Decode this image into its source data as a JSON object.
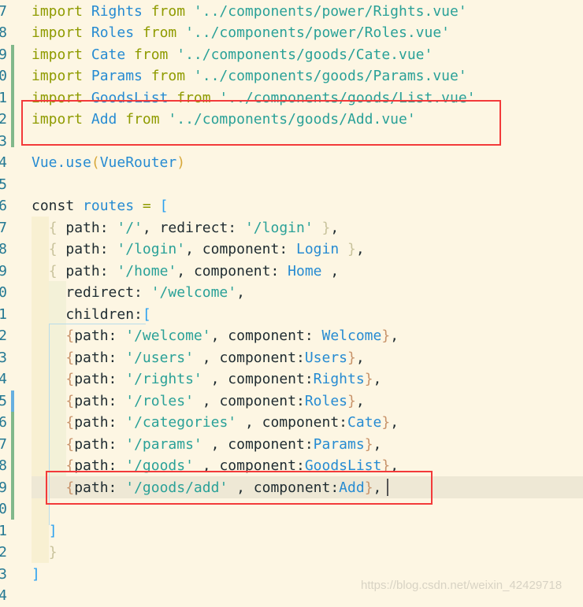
{
  "editor": {
    "colors": {
      "keyword": "#8f9b00",
      "identifier": "#268bd2",
      "string": "#2aa198",
      "highlight_box": "#f33a3a",
      "background": "#fdf6e3"
    },
    "lines": [
      {
        "n": "7",
        "tokens": [
          [
            "k",
            "import "
          ],
          [
            "i",
            "Rights "
          ],
          [
            "k",
            "from "
          ],
          [
            "s",
            "'../components/power/Rights.vue'"
          ]
        ]
      },
      {
        "n": "8",
        "tokens": [
          [
            "k",
            "import "
          ],
          [
            "i",
            "Roles "
          ],
          [
            "k",
            "from "
          ],
          [
            "s",
            "'../components/power/Roles.vue'"
          ]
        ]
      },
      {
        "n": "9",
        "tokens": [
          [
            "k",
            "import "
          ],
          [
            "i",
            "Cate "
          ],
          [
            "k",
            "from "
          ],
          [
            "s",
            "'../components/goods/Cate.vue'"
          ]
        ]
      },
      {
        "n": "0",
        "tokens": [
          [
            "k",
            "import "
          ],
          [
            "i",
            "Params "
          ],
          [
            "k",
            "from "
          ],
          [
            "s",
            "'../components/goods/Params.vue'"
          ]
        ]
      },
      {
        "n": "1",
        "tokens": [
          [
            "k",
            "import "
          ],
          [
            "i",
            "GoodsList "
          ],
          [
            "k",
            "from "
          ],
          [
            "s",
            "'../components/goods/List.vue'"
          ]
        ]
      },
      {
        "n": "2",
        "tokens": [
          [
            "k",
            "import "
          ],
          [
            "i",
            "Add "
          ],
          [
            "k",
            "from "
          ],
          [
            "s",
            "'../components/goods/Add.vue'"
          ]
        ]
      },
      {
        "n": "3",
        "tokens": []
      },
      {
        "n": "4",
        "tokens": [
          [
            "i",
            "Vue.use"
          ],
          [
            "y",
            "("
          ],
          [
            "i",
            "VueRouter"
          ],
          [
            "y",
            ")"
          ]
        ]
      },
      {
        "n": "5",
        "tokens": []
      },
      {
        "n": "6",
        "tokens": [
          [
            "p",
            "const "
          ],
          [
            "i",
            "routes "
          ],
          [
            "o",
            "= "
          ],
          [
            "l",
            "["
          ]
        ]
      },
      {
        "n": "7",
        "tokens": [
          [
            "p",
            "  "
          ],
          [
            "b",
            "{ "
          ],
          [
            "p",
            "path: "
          ],
          [
            "s",
            "'/'"
          ],
          [
            "p",
            ", redirect: "
          ],
          [
            "s",
            "'/login'"
          ],
          [
            "p",
            " "
          ],
          [
            "b",
            "}"
          ],
          [
            "p",
            ","
          ]
        ]
      },
      {
        "n": "8",
        "tokens": [
          [
            "p",
            "  "
          ],
          [
            "b",
            "{ "
          ],
          [
            "p",
            "path: "
          ],
          [
            "s",
            "'/login'"
          ],
          [
            "p",
            ", component: "
          ],
          [
            "i",
            "Login"
          ],
          [
            "p",
            " "
          ],
          [
            "b",
            "}"
          ],
          [
            "p",
            ","
          ]
        ]
      },
      {
        "n": "9",
        "tokens": [
          [
            "p",
            "  "
          ],
          [
            "b",
            "{ "
          ],
          [
            "p",
            "path: "
          ],
          [
            "s",
            "'/home'"
          ],
          [
            "p",
            ", component: "
          ],
          [
            "i",
            "Home"
          ],
          [
            "p",
            " ,"
          ]
        ]
      },
      {
        "n": "0",
        "tokens": [
          [
            "p",
            "    redirect: "
          ],
          [
            "s",
            "'/welcome'"
          ],
          [
            "p",
            ","
          ]
        ]
      },
      {
        "n": "1",
        "tokens": [
          [
            "p",
            "    children:"
          ],
          [
            "l",
            "["
          ]
        ]
      },
      {
        "n": "2",
        "tokens": [
          [
            "p",
            "    "
          ],
          [
            "r",
            "{"
          ],
          [
            "p",
            "path: "
          ],
          [
            "s",
            "'/welcome'"
          ],
          [
            "p",
            ", component: "
          ],
          [
            "i",
            "Welcome"
          ],
          [
            "r",
            "}"
          ],
          [
            "p",
            ","
          ]
        ]
      },
      {
        "n": "3",
        "tokens": [
          [
            "p",
            "    "
          ],
          [
            "r",
            "{"
          ],
          [
            "p",
            "path: "
          ],
          [
            "s",
            "'/users'"
          ],
          [
            "p",
            " , component:"
          ],
          [
            "i",
            "Users"
          ],
          [
            "r",
            "}"
          ],
          [
            "p",
            ","
          ]
        ]
      },
      {
        "n": "4",
        "tokens": [
          [
            "p",
            "    "
          ],
          [
            "r",
            "{"
          ],
          [
            "p",
            "path: "
          ],
          [
            "s",
            "'/rights'"
          ],
          [
            "p",
            " , component:"
          ],
          [
            "i",
            "Rights"
          ],
          [
            "r",
            "}"
          ],
          [
            "p",
            ","
          ]
        ]
      },
      {
        "n": "5",
        "tokens": [
          [
            "p",
            "    "
          ],
          [
            "r",
            "{"
          ],
          [
            "p",
            "path: "
          ],
          [
            "s",
            "'/roles'"
          ],
          [
            "p",
            " , component:"
          ],
          [
            "i",
            "Roles"
          ],
          [
            "r",
            "}"
          ],
          [
            "p",
            ","
          ]
        ]
      },
      {
        "n": "6",
        "tokens": [
          [
            "p",
            "    "
          ],
          [
            "r",
            "{"
          ],
          [
            "p",
            "path: "
          ],
          [
            "s",
            "'/categories'"
          ],
          [
            "p",
            " , component:"
          ],
          [
            "i",
            "Cate"
          ],
          [
            "r",
            "}"
          ],
          [
            "p",
            ","
          ]
        ]
      },
      {
        "n": "7",
        "tokens": [
          [
            "p",
            "    "
          ],
          [
            "r",
            "{"
          ],
          [
            "p",
            "path: "
          ],
          [
            "s",
            "'/params'"
          ],
          [
            "p",
            " , component:"
          ],
          [
            "i",
            "Params"
          ],
          [
            "r",
            "}"
          ],
          [
            "p",
            ","
          ]
        ]
      },
      {
        "n": "8",
        "tokens": [
          [
            "p",
            "    "
          ],
          [
            "r",
            "{"
          ],
          [
            "p",
            "path: "
          ],
          [
            "s",
            "'/goods'"
          ],
          [
            "p",
            " , component:"
          ],
          [
            "i",
            "GoodsList"
          ],
          [
            "r",
            "}"
          ],
          [
            "p",
            ","
          ]
        ]
      },
      {
        "n": "9",
        "tokens": [
          [
            "p",
            "    "
          ],
          [
            "r",
            "{"
          ],
          [
            "p",
            "path: "
          ],
          [
            "s",
            "'/goods/add'"
          ],
          [
            "p",
            " , component:"
          ],
          [
            "i",
            "Add"
          ],
          [
            "r",
            "}"
          ],
          [
            "p",
            ","
          ]
        ]
      },
      {
        "n": "0",
        "tokens": []
      },
      {
        "n": "1",
        "tokens": [
          [
            "p",
            "  "
          ],
          [
            "l",
            "]"
          ]
        ]
      },
      {
        "n": "2",
        "tokens": [
          [
            "p",
            "  "
          ],
          [
            "b",
            "}"
          ]
        ]
      },
      {
        "n": "3",
        "tokens": [
          [
            "l",
            "]"
          ]
        ]
      },
      {
        "n": "4",
        "tokens": []
      }
    ]
  },
  "watermark": "https://blog.csdn.net/weixin_42429718"
}
